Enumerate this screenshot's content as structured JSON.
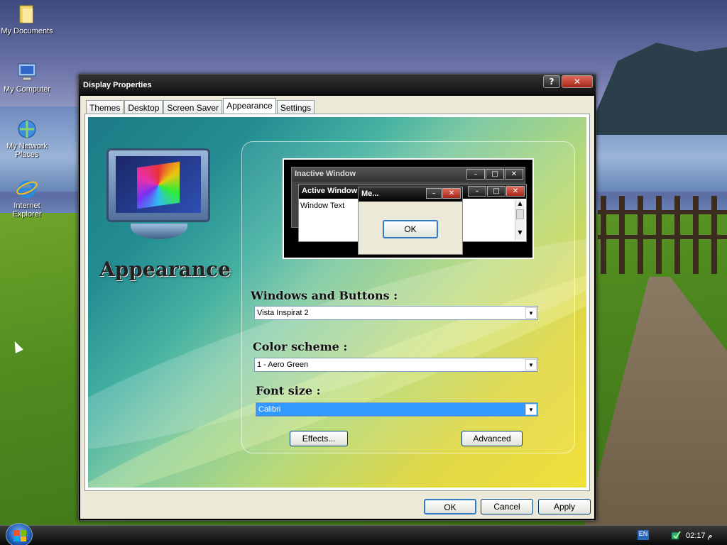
{
  "desktop": {
    "icons": [
      {
        "label": "My Documents",
        "icon": "folder-icon"
      },
      {
        "label": "My Computer",
        "icon": "computer-icon"
      },
      {
        "label": "My Network Places",
        "icon": "network-icon"
      },
      {
        "label": "Internet Explorer",
        "icon": "ie-icon"
      }
    ]
  },
  "window": {
    "title": "Display Properties",
    "help_label": "?",
    "close_label": "✕",
    "tabs": [
      {
        "label": "Themes"
      },
      {
        "label": "Desktop"
      },
      {
        "label": "Screen Saver"
      },
      {
        "label": "Appearance"
      },
      {
        "label": "Settings"
      }
    ],
    "active_tab": "Appearance",
    "heading": "Appearance",
    "preview": {
      "inactive_title": "Inactive Window",
      "active_title": "Active Window",
      "window_text": "Window Text",
      "message_title": "Me...",
      "ok_label": "OK"
    },
    "fields": {
      "windows_buttons_label": "Windows and Buttons :",
      "windows_buttons_value": "Vista Inspirat 2",
      "color_scheme_label": "Color scheme :",
      "color_scheme_value": "1 - Aero Green",
      "font_size_label": "Font size :",
      "font_size_value": "Calibri"
    },
    "buttons": {
      "effects": "Effects...",
      "advanced": "Advanced",
      "ok": "OK",
      "cancel": "Cancel",
      "apply": "Apply"
    }
  },
  "taskbar": {
    "lang": "EN",
    "clock": "02:17 م"
  }
}
